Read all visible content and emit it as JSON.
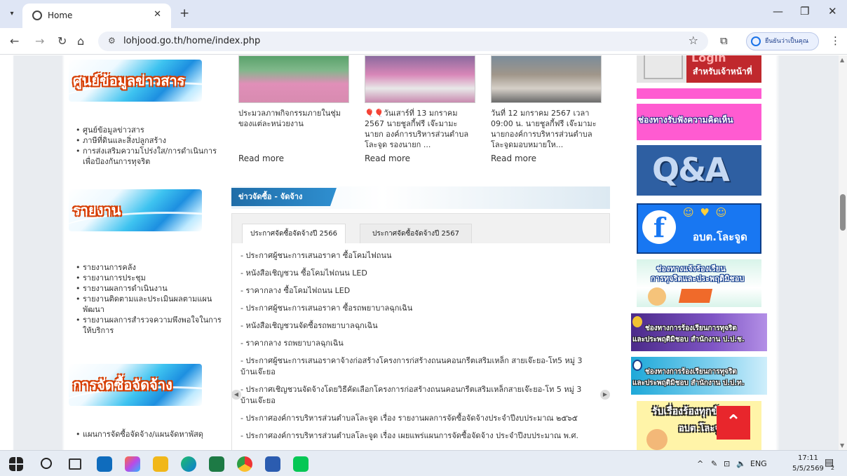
{
  "browser": {
    "tab_title": "Home",
    "url": "lohjood.go.th/home/index.php",
    "profile_label": "ยืนยันว่าเป็นคุณ"
  },
  "sidebar": {
    "section1": {
      "title": "ศูนย์ข้อมูลข่าวสาร",
      "items": [
        "ศูนย์ข้อมูลข่าวสาร",
        "ภาษีที่ดินและสิ่งปลูกสร้าง",
        "การส่งเสริมความโปร่งใส/การดำเนินการเพื่อป้องกันการทุจริต"
      ]
    },
    "section2": {
      "title": "รายงาน",
      "items": [
        "รายงานการคลัง",
        "รายงานการประชุม",
        "รายงานผลการดำเนินงาน",
        "รายงานติดตามและประเมินผลตามแผนพัฒนา",
        "รายงานผลการสำรวจความพึงพอใจในการให้บริการ"
      ]
    },
    "section3": {
      "title": "การจัดซื้อจัดจ้าง",
      "items": [
        "แผนการจัดซื้อจัดจ้าง/แผนจัดหาพัสดุ"
      ]
    }
  },
  "news": [
    {
      "caption": "ประมวลภาพกิจกรรมภายในชุ่มของแต่ละหน่วยงาน",
      "more": "Read more"
    },
    {
      "caption": "🎈🎈วันเสาร์ที่ 13 มกราคม 2567 นายชูลกี้ฟรี เจ๊ะมามะ นายก องค์การบริหารส่วนตำบลโละจูด รองนายก ...",
      "more": "Read more"
    },
    {
      "caption": "วันที่ 12 มกราคม 2567 เวลา 09:00 น. นายชูลกี้ฟรี เจ๊ะมามะ นายกองค์การบริหารส่วนตำบลโละจูดมอบหมายให...",
      "more": "Read more"
    }
  ],
  "procurement": {
    "header": "ข่าวจัดซื้อ - จัดจ้าง",
    "tabs": [
      "ประกาศจัดซื้อจัดจ้างปี 2566",
      "ประกาศจัดซื้อจัดจ้างปี 2567"
    ],
    "items": [
      "- ประกาศผู้ชนะการเสนอราคา ซื้อโคมไฟถนน",
      "- หนังสือเชิญชวน ซื้อโคมไฟถนน LED",
      "- ราคากลาง ซื้อโคมไฟถนน LED",
      "- ประกาศผู้ชนะการเสนอราคา ซื้อรถพยาบาลฉุกเฉิน",
      "- หนังสือเชิญชวนจัดซื้อรถพยาบาลฉุกเฉิน",
      "- ราคากลาง รถพยาบาลฉุกเฉิน",
      "- ประกาศผู้ชนะการเสนอราคาจ้างก่อสร้างโครงการก่สร้างถนนคอนกรีตเสริมเหล็ก สายเจ๊ะยอ-โท5 หมู่ 3 บ้านเจ๊ะยอ",
      "- ประกาศเชิญชวนจัดจ้างโดยวิธีคัดเลือกโครงการก่อสร้างถนนคอนกรีตเสริมเหล็กสายเจ๊ะยอ-โท 5 หมู่ 3 บ้านเจ๊ะยอ",
      "- ประกาศองค์การบริหารส่วนตำบลโละจูด เรื่อง รายงานผลการจัดซื้อจัดจ้างประจำปีงบประมาณ ๒๕๖๕",
      "- ประกาศองค์การบริหารส่วนตำบลโละจูด เรื่อง เผยแพร่แผนการจัดซื้อจัดจ้าง ประจำปีงบประมาณ พ.ศ."
    ]
  },
  "right_banners": {
    "login_top": "Login",
    "login_sub": "สำหรับเจ้าหน้าที่",
    "opinion": "ช่องทางรับฟังความคิดเห็น",
    "qa": "Q&A",
    "facebook": "อบต.โละจูด",
    "complaint_line1": "ช่องทางแจ้งร้องเรียน",
    "complaint_line2": "การทุจริตและประพฤติมิชอบ",
    "pacc_line1": "ช่องทางการร้องเรียนการทุจริต",
    "pacc_line2": "และประพฤติมิชอบ สำนักงาน ป.ป.ช.",
    "ppt_line1": "ช่องทางการร้องเรียนการทุจริต",
    "ppt_line2": "และประพฤติมิชอบ สำนักงาน ป.ป.ท.",
    "grievance_line1": "รับเรื่องร้องทุกข์",
    "grievance_line2": "อบต.โละจูด"
  },
  "taskbar": {
    "lang": "ENG",
    "time": "17:11",
    "date": "5/5/2569",
    "notif_count": "2"
  }
}
